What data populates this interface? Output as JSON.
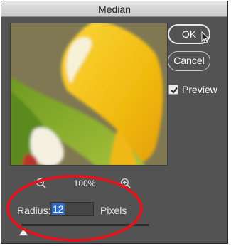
{
  "dialog": {
    "title": "Median"
  },
  "buttons": {
    "ok_label": "OK",
    "cancel_label": "Cancel"
  },
  "preview_toggle": {
    "label": "Preview",
    "checked": true
  },
  "zoom": {
    "level": "100%",
    "zoom_out_icon": "zoom-out-magnifier",
    "zoom_in_icon": "zoom-in-magnifier"
  },
  "radius": {
    "label": "Radius:",
    "value": "12",
    "unit": "Pixels"
  },
  "slider": {
    "value": 12,
    "fraction": 0.0
  },
  "colors": {
    "dialog_bg": "#535353",
    "selection": "#2e6bc9",
    "annotation": "#e0141c",
    "flower_yellow": "#f3c313"
  }
}
